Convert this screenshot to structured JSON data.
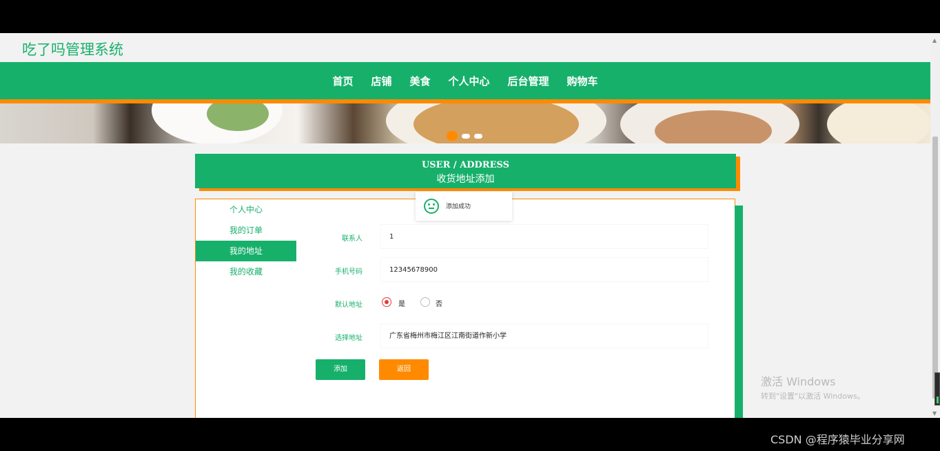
{
  "site": {
    "title": "吃了吗管理系统"
  },
  "nav": {
    "items": [
      "首页",
      "店铺",
      "美食",
      "个人中心",
      "后台管理",
      "购物车"
    ]
  },
  "header": {
    "en": "USER / ADDRESS",
    "cn": "收货地址添加"
  },
  "sidebar": {
    "items": [
      "个人中心",
      "我的订单",
      "我的地址",
      "我的收藏"
    ],
    "active_index": 2
  },
  "form": {
    "contact": {
      "label": "联系人",
      "value": "1"
    },
    "phone": {
      "label": "手机号码",
      "value": "12345678900"
    },
    "default": {
      "label": "默认地址",
      "yes": "是",
      "no": "否",
      "selected": "是"
    },
    "address": {
      "label": "选择地址",
      "value": "广东省梅州市梅江区江南街道作新小学"
    },
    "add_button": "添加",
    "back_button": "返回"
  },
  "toast": {
    "text": "添加成功"
  },
  "watermark": {
    "line1": "激活 Windows",
    "line2": "转到\"设置\"以激活 Windows。"
  },
  "footer": {
    "csdn": "CSDN @程序猿毕业分享网"
  },
  "colors": {
    "primary": "#17b06b",
    "accent": "#ff8a00"
  }
}
